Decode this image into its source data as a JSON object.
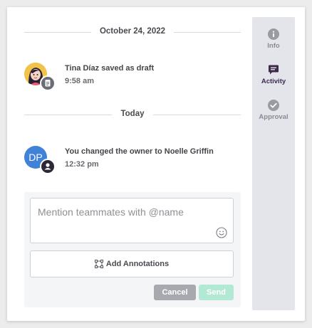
{
  "timeline": {
    "date_divider_1": "October 24, 2022",
    "date_divider_2": "Today",
    "activities": [
      {
        "title": "Tina Díaz saved as draft",
        "time": "9:58 am"
      },
      {
        "title": "You changed the owner to Noelle Griffin",
        "time": "12:32 pm",
        "avatar_initials": "DP"
      }
    ]
  },
  "comment": {
    "placeholder": "Mention teammates with @name",
    "annotations_label": "Add Annotations",
    "cancel_label": "Cancel",
    "send_label": "Send"
  },
  "sidebar": {
    "items": [
      {
        "label": "Info",
        "icon": "info-icon",
        "active": false
      },
      {
        "label": "Activity",
        "icon": "chat-icon",
        "active": true
      },
      {
        "label": "Approval",
        "icon": "check-circle-icon",
        "active": false
      }
    ]
  },
  "colors": {
    "avatar_blue": "#3f82d8",
    "active_nav": "#3d2a4c",
    "inactive_nav": "#9a9aa2",
    "send_disabled": "#b2e9d4",
    "cancel": "#a7a9ae"
  }
}
